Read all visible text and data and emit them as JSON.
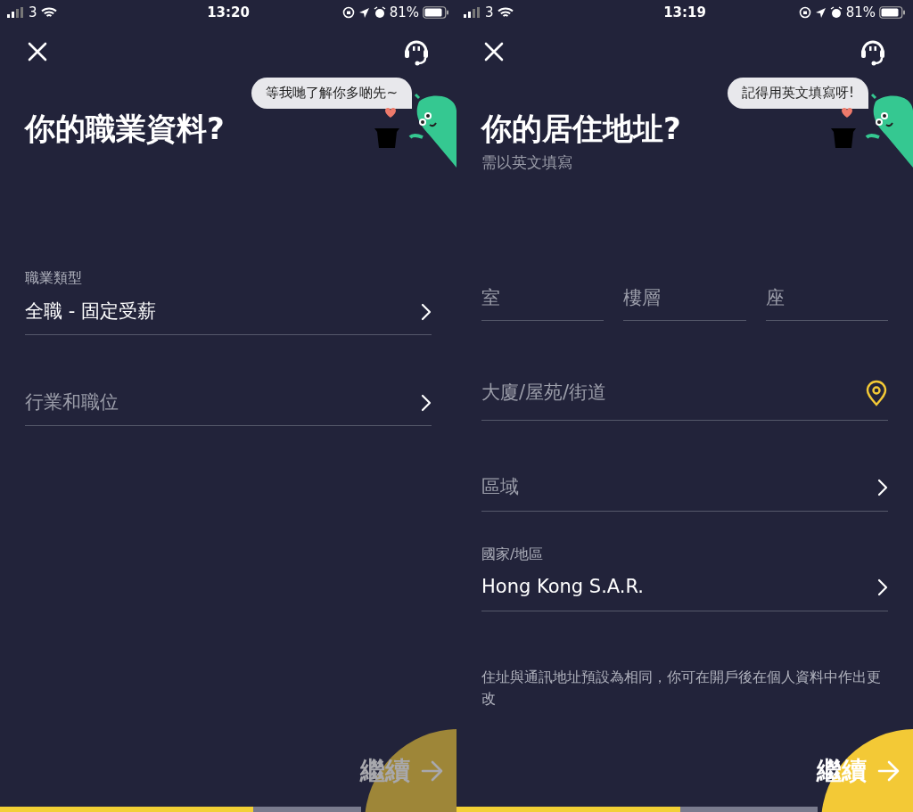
{
  "screens": [
    {
      "status_bar": {
        "carrier": "3",
        "time": "13:20",
        "battery": "81%"
      },
      "speech_bubble": "等我哋了解你多啲先~",
      "title": "你的職業資料?",
      "fields": [
        {
          "kind": "select",
          "label": "職業類型",
          "value": "全職 - 固定受薪"
        },
        {
          "kind": "select",
          "placeholder": "行業和職位"
        }
      ],
      "continue_button": {
        "label": "繼續",
        "disabled": true
      },
      "progress": {
        "level": 0.7
      }
    },
    {
      "status_bar": {
        "carrier": "3",
        "time": "13:19",
        "battery": "81%"
      },
      "speech_bubble": "記得用英文填寫呀!",
      "title": "你的居住地址?",
      "subtitle": "需以英文填寫",
      "fields": [
        {
          "kind": "split",
          "parts": [
            {
              "placeholder": "室"
            },
            {
              "placeholder": "樓層"
            },
            {
              "placeholder": "座"
            }
          ]
        },
        {
          "kind": "location",
          "placeholder": "大廈/屋苑/街道"
        },
        {
          "kind": "select",
          "placeholder": "區域"
        },
        {
          "kind": "select",
          "label": "國家/地區",
          "value": "Hong Kong S.A.R."
        }
      ],
      "note": "住址與通訊地址預設為相同，你可在開戶後在個人資料中作出更改",
      "continue_button": {
        "label": "繼續",
        "disabled": false
      },
      "progress": {
        "level": 0.62
      }
    }
  ]
}
